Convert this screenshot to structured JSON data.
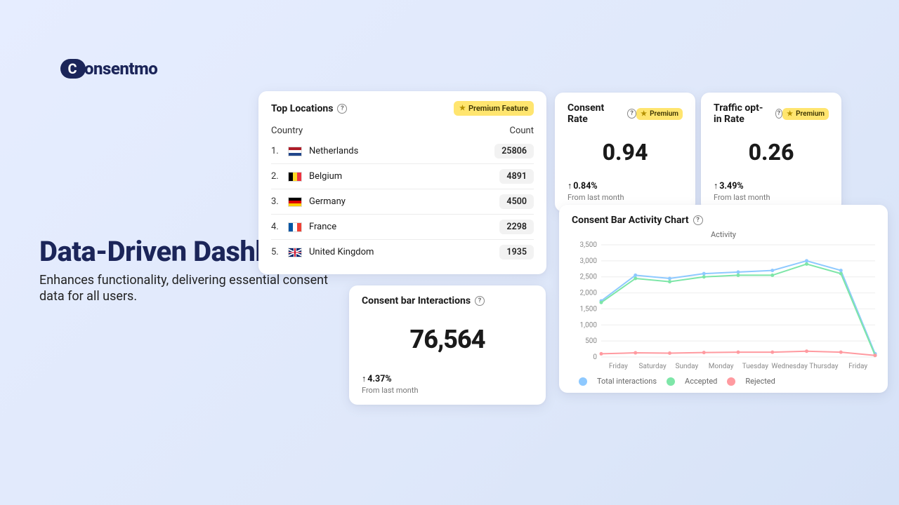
{
  "logo": {
    "text": "onsentmo"
  },
  "headline": {
    "title": "Data-Driven Dashboard",
    "subtitle": "Enhances functionality, delivering essential consent data for all users."
  },
  "badges": {
    "premium_feature": "Premium Feature",
    "premium": "Premium"
  },
  "top_locations": {
    "title": "Top Locations",
    "col_country": "Country",
    "col_count": "Count",
    "rows": [
      {
        "rank": "1.",
        "name": "Netherlands",
        "flag": "nl",
        "count": "25806"
      },
      {
        "rank": "2.",
        "name": "Belgium",
        "flag": "be",
        "count": "4891"
      },
      {
        "rank": "3.",
        "name": "Germany",
        "flag": "de",
        "count": "4500"
      },
      {
        "rank": "4.",
        "name": "France",
        "flag": "fr",
        "count": "2298"
      },
      {
        "rank": "5.",
        "name": "United Kingdom",
        "flag": "uk",
        "count": "1935"
      }
    ]
  },
  "consent_rate": {
    "title": "Consent Rate",
    "value": "0.94",
    "delta": "0.84%",
    "sub": "From last month"
  },
  "traffic_rate": {
    "title": "Traffic opt-in Rate",
    "value": "0.26",
    "delta": "3.49%",
    "sub": "From last month"
  },
  "interactions": {
    "title": "Consent bar Interactions",
    "value": "76,564",
    "delta": "4.37%",
    "sub": "From last month"
  },
  "activity": {
    "title": "Consent Bar Activity Chart",
    "chart_title": "Activity",
    "legend": {
      "total": "Total interactions",
      "accepted": "Accepted",
      "rejected": "Rejected"
    }
  },
  "chart_data": {
    "type": "line",
    "title": "Activity",
    "xlabel": "",
    "ylabel": "",
    "ylim": [
      0,
      3500
    ],
    "y_ticks": [
      "3,500",
      "3,000",
      "2,500",
      "2,000",
      "1,500",
      "1,000",
      "500",
      "0"
    ],
    "categories": [
      "Friday",
      "Saturday",
      "Sunday",
      "Monday",
      "Tuesday",
      "Wednesday",
      "Thursday",
      "Friday"
    ],
    "series": [
      {
        "name": "Total interactions",
        "color": "#8ec9ff",
        "values": [
          1750,
          2550,
          2450,
          2600,
          2650,
          2700,
          3000,
          2700,
          100
        ]
      },
      {
        "name": "Accepted",
        "color": "#7ee6a8",
        "values": [
          1700,
          2450,
          2350,
          2500,
          2550,
          2550,
          2900,
          2600,
          50
        ]
      },
      {
        "name": "Rejected",
        "color": "#ff9aa0",
        "values": [
          100,
          130,
          120,
          140,
          150,
          150,
          180,
          150,
          50
        ]
      }
    ],
    "note": "series have 9 points spanning 8 x-tick labels; final point drops sharply"
  }
}
